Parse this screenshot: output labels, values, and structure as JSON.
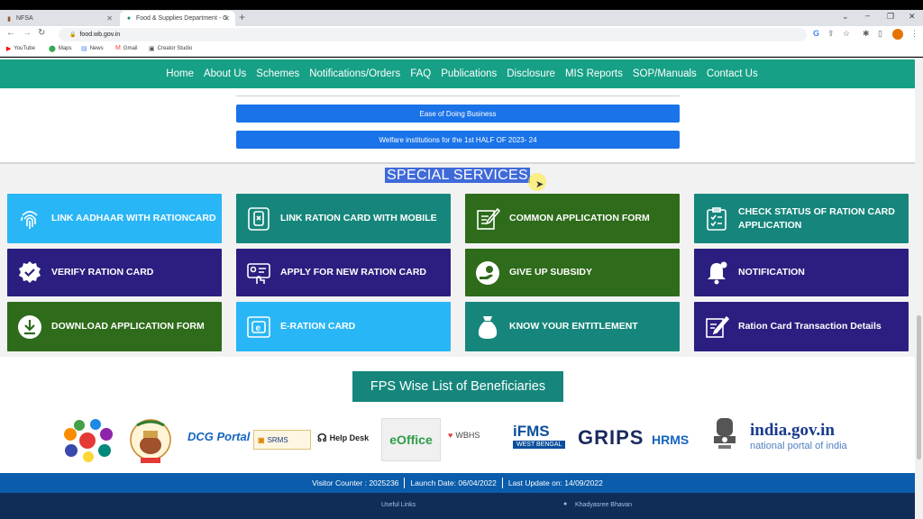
{
  "browser": {
    "tabs": [
      {
        "label": "NFSA",
        "icon": "nfsa-favicon"
      },
      {
        "label": "Food & Supplies Department - G",
        "icon": "wb-favicon"
      }
    ],
    "url": "food.wb.gov.in",
    "bookmarks": [
      {
        "label": "YouTube",
        "icon": "youtube-icon"
      },
      {
        "label": "Maps",
        "icon": "maps-icon"
      },
      {
        "label": "News",
        "icon": "news-icon"
      },
      {
        "label": "Gmail",
        "icon": "gmail-icon"
      },
      {
        "label": "Creator Studio",
        "icon": "creator-studio-icon"
      }
    ]
  },
  "nav": {
    "items": [
      "Home",
      "About Us",
      "Schemes",
      "Notifications/Orders",
      "FAQ",
      "Publications",
      "Disclosure",
      "MIS Reports",
      "SOP/Manuals",
      "Contact Us"
    ]
  },
  "links": {
    "ease": "Ease of Doing Business",
    "welfare": "Welfare institutions for the 1st HALF OF 2023- 24"
  },
  "special": {
    "title": "SPECIAL SERVICES",
    "cards": [
      {
        "label": "LINK AADHAAR WITH RATIONCARD",
        "icon": "fingerprint-icon",
        "color": "#29b6f6"
      },
      {
        "label": "LINK RATION CARD WITH MOBILE",
        "icon": "mobile-icon",
        "color": "#16867c"
      },
      {
        "label": "COMMON APPLICATION FORM",
        "icon": "form-pen-icon",
        "color": "#2e6b1a"
      },
      {
        "label": "CHECK STATUS OF RATION CARD APPLICATION",
        "icon": "checklist-icon",
        "color": "#16867c"
      },
      {
        "label": "VERIFY RATION CARD",
        "icon": "verified-badge-icon",
        "color": "#2a1f80"
      },
      {
        "label": "APPLY FOR NEW RATION CARD",
        "icon": "apply-card-icon",
        "color": "#2a1f80"
      },
      {
        "label": "GIVE UP SUBSIDY",
        "icon": "hand-coin-icon",
        "color": "#2e6b1a"
      },
      {
        "label": "NOTIFICATION",
        "icon": "bell-icon",
        "color": "#2a1f80"
      },
      {
        "label": "DOWNLOAD APPLICATION FORM",
        "icon": "download-icon",
        "color": "#2e6b1a"
      },
      {
        "label": "E-RATION CARD",
        "icon": "e-card-icon",
        "color": "#29b6f6"
      },
      {
        "label": "KNOW YOUR ENTITLEMENT",
        "icon": "sack-icon",
        "color": "#16867c"
      },
      {
        "label": "Ration Card Transaction Details",
        "icon": "edit-document-icon",
        "color": "#2a1f80"
      }
    ]
  },
  "fps": {
    "label": "FPS Wise List of Beneficiaries"
  },
  "logos": {
    "dcg": "DCG Portal",
    "srms": "SRMS",
    "helpdesk": "Help Desk",
    "eoffice": "eOffice",
    "wbhs": "WBHS",
    "ifms": "iFMS",
    "ifms_sub": "WEST BENGAL",
    "grips": "GRIPS",
    "hrms": "HRMS",
    "india": "india.gov.in",
    "india_sub": "national portal of india"
  },
  "footer": {
    "visitor": "Visitor Counter : 2025236",
    "launch": "Launch Date: 06/04/2022",
    "update": "Last Update on: 14/09/2022",
    "useful": "Useful Links",
    "khadya": "Khadyasree Bhavan"
  }
}
